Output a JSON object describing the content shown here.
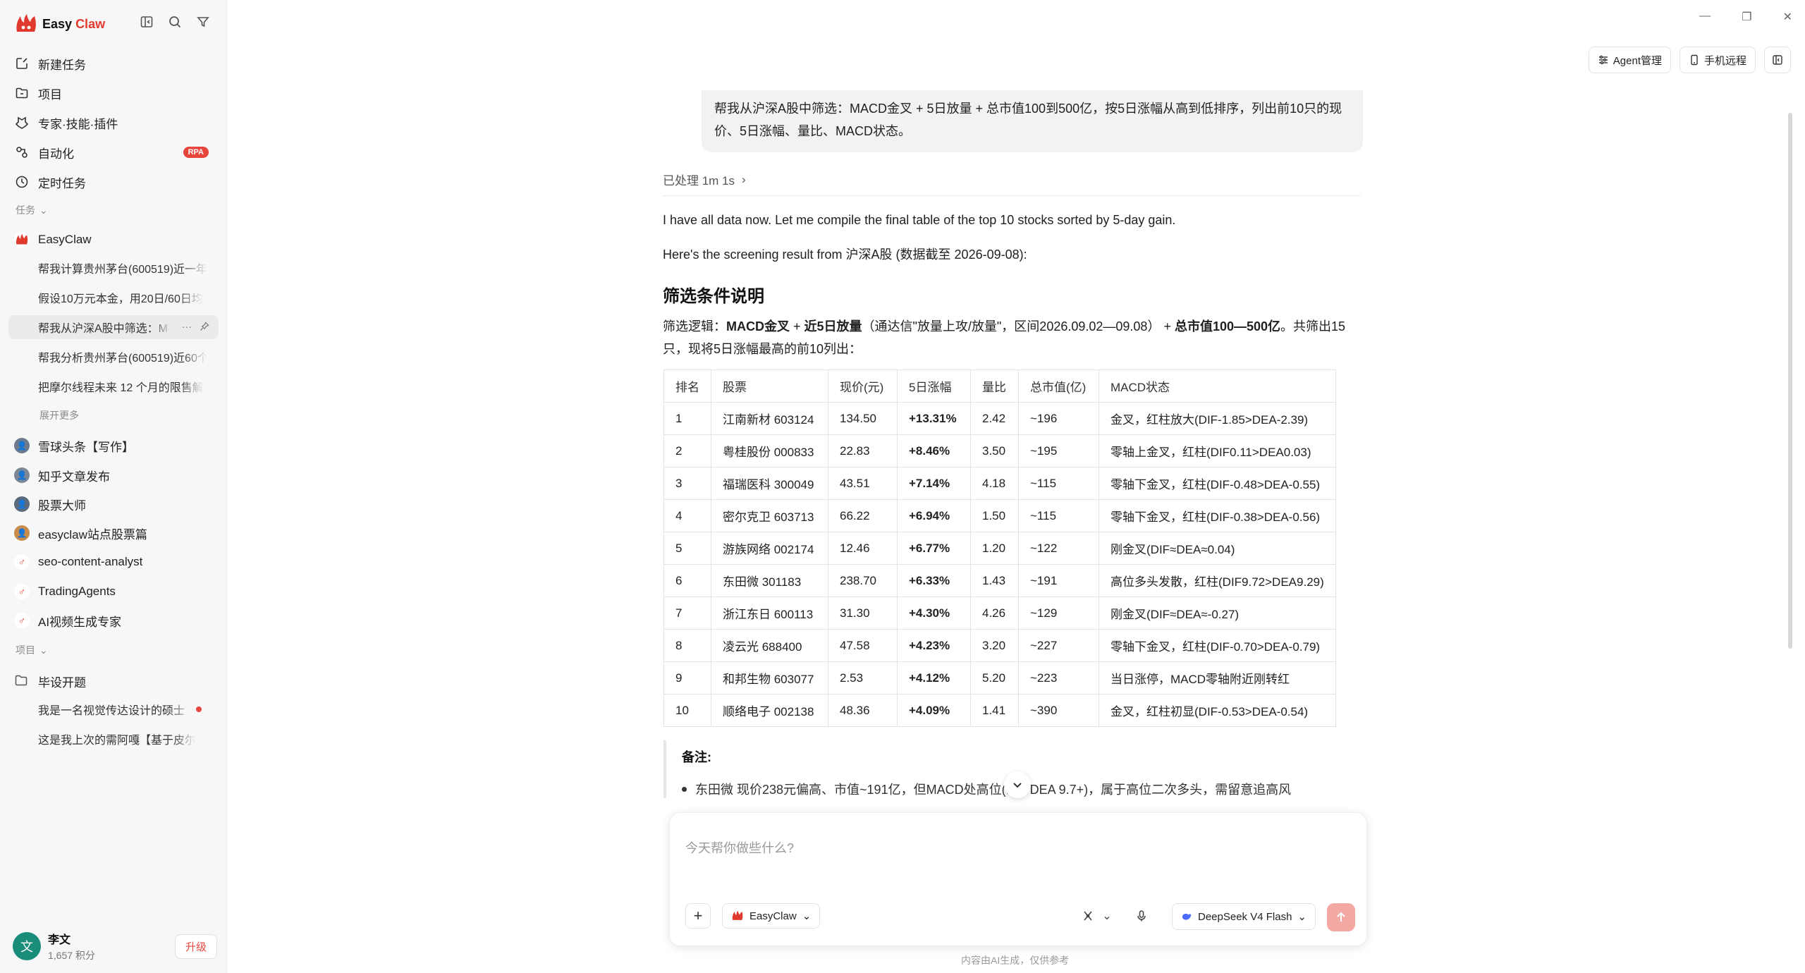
{
  "app": {
    "logo_easy": "Easy",
    "logo_claw": "Claw"
  },
  "sidebar": {
    "nav": [
      {
        "label": "新建任务",
        "icon": "new-task-icon"
      },
      {
        "label": "项目",
        "icon": "folder-icon"
      },
      {
        "label": "专家·技能·插件",
        "icon": "puzzle-icon"
      },
      {
        "label": "自动化",
        "icon": "automation-icon",
        "badge": "RPA"
      },
      {
        "label": "定时任务",
        "icon": "clock-icon"
      }
    ],
    "tasks_label": "任务",
    "group_easyclaw": "EasyClaw",
    "task_items": [
      "帮我计算贵州茅台(600519)近一年",
      "假设10万元本金，用20日/60日均",
      "帮我从沪深A股中筛选：M",
      "帮我分析贵州茅台(600519)近60个",
      "把摩尔线程未来 12 个月的限售解"
    ],
    "show_more": "展开更多",
    "agents": [
      {
        "label": "雪球头条【写作】"
      },
      {
        "label": "知乎文章发布"
      },
      {
        "label": "股票大师"
      },
      {
        "label": "easyclaw站点股票篇"
      },
      {
        "label": "seo-content-analyst"
      },
      {
        "label": "TradingAgents"
      },
      {
        "label": "AI视频生成专家"
      }
    ],
    "projects_label": "项目",
    "project_name": "毕设开题",
    "project_items": [
      "我是一名视觉传达设计的硕士",
      "这是我上次的需阿嘎【基于皮尔"
    ],
    "user": {
      "avatar_char": "文",
      "name": "李文",
      "points": "1,657 积分",
      "upgrade": "升级"
    }
  },
  "topbar": {
    "agent_manage": "Agent管理",
    "phone_remote": "手机远程"
  },
  "chat": {
    "user_message": "帮我从沪深A股中筛选：MACD金叉 + 5日放量 + 总市值100到500亿，按5日涨幅从高到低排序，列出前10只的现价、5日涨幅、量比、MACD状态。",
    "processed": "已处理 1m 1s",
    "ai_line1": "I have all data now. Let me compile the final table of the top 10 stocks sorted by 5-day gain.",
    "ai_line2": "Here's the screening result from 沪深A股 (数据截至 2026-09-08):",
    "heading": "筛选条件说明",
    "logic": {
      "prefix": "筛选逻辑：",
      "c1": "MACD金叉",
      "plus1": " + ",
      "c2": "近5日放量",
      "c2_note": "（通达信\"放量上攻/放量\"，区间2026.09.02—09.08）",
      "plus2": " + ",
      "c3": "总市值100—500亿",
      "suffix": "。共筛出15只，现将5日涨幅最高的前10列出："
    },
    "table": {
      "headers": [
        "排名",
        "股票",
        "现价(元)",
        "5日涨幅",
        "量比",
        "总市值(亿)",
        "MACD状态"
      ],
      "rows": [
        [
          "1",
          "江南新材 603124",
          "134.50",
          "+13.31%",
          "2.42",
          "~196",
          "金叉，红柱放大(DIF-1.85>DEA-2.39)"
        ],
        [
          "2",
          "粤桂股份 000833",
          "22.83",
          "+8.46%",
          "3.50",
          "~195",
          "零轴上金叉，红柱(DIF0.11>DEA0.03)"
        ],
        [
          "3",
          "福瑞医科 300049",
          "43.51",
          "+7.14%",
          "4.18",
          "~115",
          "零轴下金叉，红柱(DIF-0.48>DEA-0.55)"
        ],
        [
          "4",
          "密尔克卫 603713",
          "66.22",
          "+6.94%",
          "1.50",
          "~115",
          "零轴下金叉，红柱(DIF-0.38>DEA-0.56)"
        ],
        [
          "5",
          "游族网络 002174",
          "12.46",
          "+6.77%",
          "1.20",
          "~122",
          "刚金叉(DIF≈DEA≈0.04)"
        ],
        [
          "6",
          "东田微 301183",
          "238.70",
          "+6.33%",
          "1.43",
          "~191",
          "高位多头发散，红柱(DIF9.72>DEA9.29)"
        ],
        [
          "7",
          "浙江东日 600113",
          "31.30",
          "+4.30%",
          "4.26",
          "~129",
          "刚金叉(DIF≈DEA≈-0.27)"
        ],
        [
          "8",
          "凌云光 688400",
          "47.58",
          "+4.23%",
          "3.20",
          "~227",
          "零轴下金叉，红柱(DIF-0.70>DEA-0.79)"
        ],
        [
          "9",
          "和邦生物 603077",
          "2.53",
          "+4.12%",
          "5.20",
          "~223",
          "当日涨停，MACD零轴附近刚转红"
        ],
        [
          "10",
          "顺络电子 002138",
          "48.36",
          "+4.09%",
          "1.41",
          "~390",
          "金叉，红柱初显(DIF-0.53>DEA-0.54)"
        ]
      ]
    },
    "note_title": "备注:",
    "note_item": "东田微 现价238元偏高、市值~191亿，但MACD处高位(DIF/DEA 9.7+)，属于高位二次多头，需留意追高风"
  },
  "composer": {
    "placeholder": "今天帮你做些什么?",
    "agent": "EasyClaw",
    "model": "DeepSeek V4 Flash",
    "disclaimer": "内容由AI生成，仅供参考"
  }
}
